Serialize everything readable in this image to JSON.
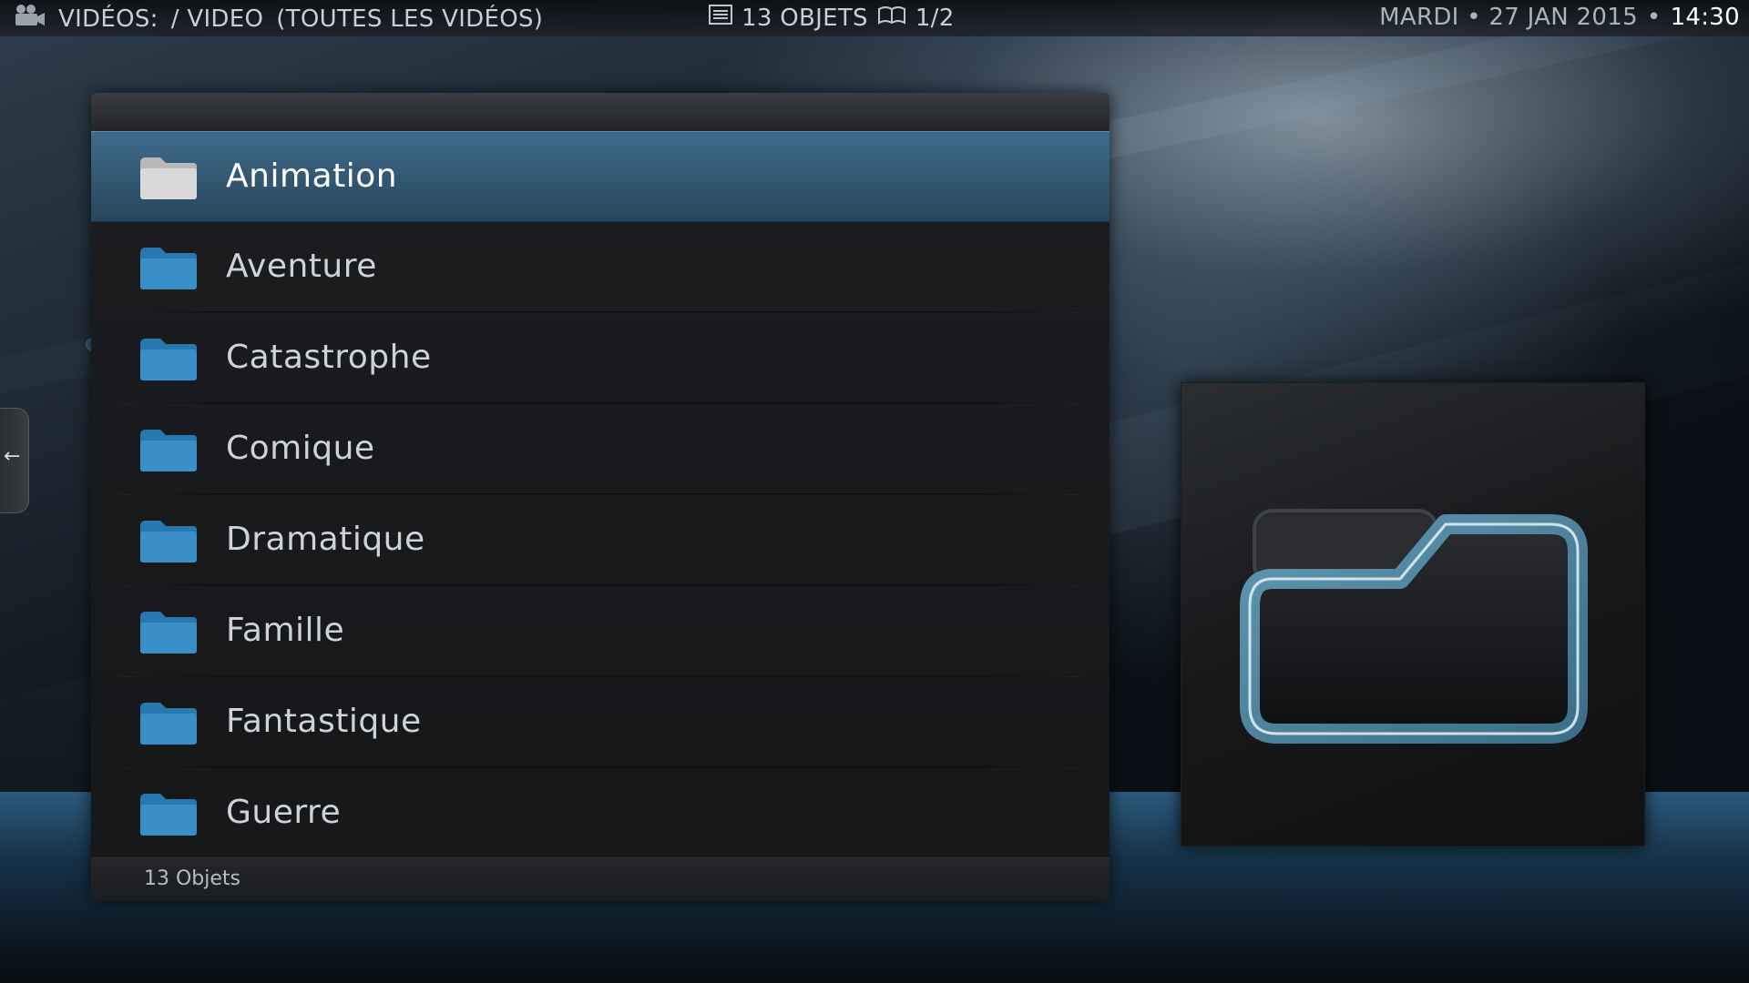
{
  "topbar": {
    "section": "VIDÉOS:",
    "path": "/ VIDEO",
    "filter": "(TOUTES LES VIDÉOS)",
    "count": "13 OBJETS",
    "page": "1/2",
    "date": "MARDI • 27 JAN 2015",
    "separator": "•",
    "time": "14:30",
    "icons": {
      "section": "film-camera-icon",
      "count": "list-icon",
      "page": "book-icon"
    }
  },
  "list": {
    "items": [
      {
        "label": "Animation",
        "selected": true
      },
      {
        "label": "Aventure"
      },
      {
        "label": "Catastrophe"
      },
      {
        "label": "Comique"
      },
      {
        "label": "Dramatique"
      },
      {
        "label": "Famille"
      },
      {
        "label": "Fantastique"
      },
      {
        "label": "Guerre"
      }
    ],
    "footer": "13 Objets",
    "folder_icon": "folder-icon"
  },
  "side_tab": {
    "arrow": "←"
  },
  "preview": {
    "icon": "folder-icon"
  },
  "colors": {
    "accent": "#4b96c8",
    "selected_row": "#3f6b8a",
    "folder_blue": "#3b8fc9",
    "folder_selected": "#d9d9d9",
    "preview_outline": "#6aa8c2"
  }
}
